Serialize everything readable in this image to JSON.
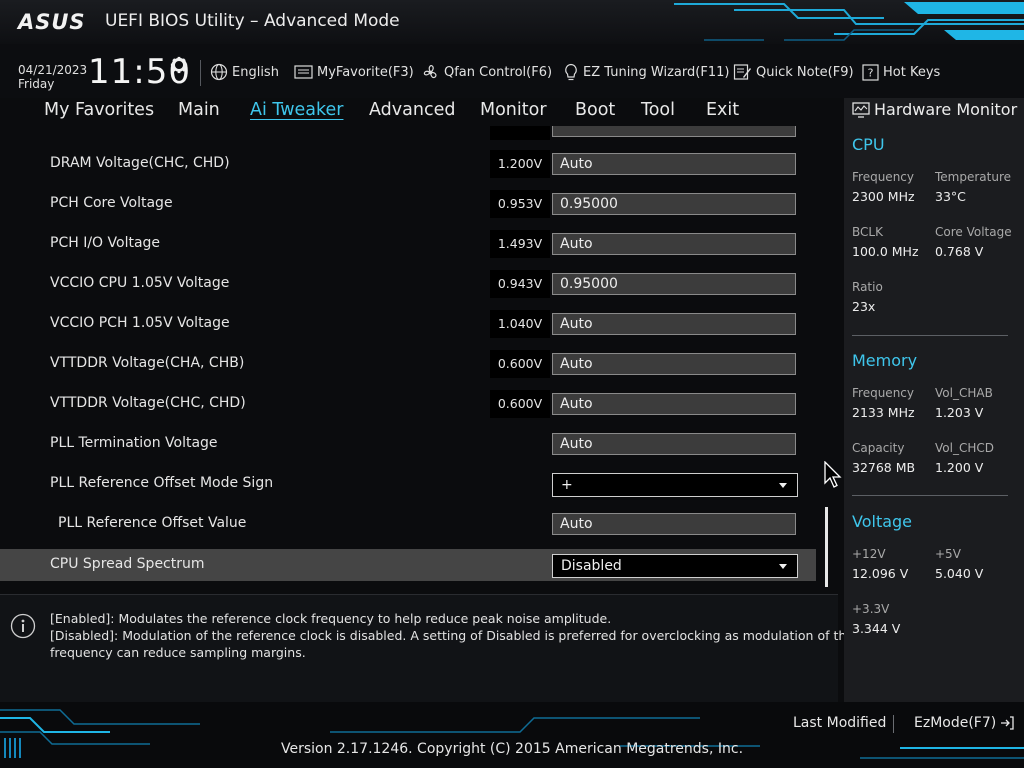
{
  "header": {
    "logo": "ASUS",
    "title": "UEFI BIOS Utility – Advanced Mode"
  },
  "infobar": {
    "date": "04/21/2023",
    "day": "Friday",
    "time": "11:50",
    "tools": [
      {
        "label": "English",
        "icon": "globe-icon"
      },
      {
        "label": "MyFavorite(F3)",
        "icon": "favorite-icon"
      },
      {
        "label": "Qfan Control(F6)",
        "icon": "fan-icon"
      },
      {
        "label": "EZ Tuning Wizard(F11)",
        "icon": "bulb-icon"
      },
      {
        "label": "Quick Note(F9)",
        "icon": "note-icon"
      },
      {
        "label": "Hot Keys",
        "icon": "hotkeys-icon"
      }
    ]
  },
  "menu": {
    "tabs": [
      "My Favorites",
      "Main",
      "Ai Tweaker",
      "Advanced",
      "Monitor",
      "Boot",
      "Tool",
      "Exit"
    ],
    "active": "Ai Tweaker"
  },
  "settings": {
    "rows": [
      {
        "label": "DRAM Voltage(CHC, CHD)",
        "reading": "1.200V",
        "value": "Auto",
        "control": "field"
      },
      {
        "label": "PCH Core Voltage",
        "reading": "0.953V",
        "value": "0.95000",
        "control": "field"
      },
      {
        "label": "PCH I/O Voltage",
        "reading": "1.493V",
        "value": "Auto",
        "control": "field"
      },
      {
        "label": "VCCIO CPU 1.05V Voltage",
        "reading": "0.943V",
        "value": "0.95000",
        "control": "field"
      },
      {
        "label": "VCCIO PCH 1.05V Voltage",
        "reading": "1.040V",
        "value": "Auto",
        "control": "field"
      },
      {
        "label": "VTTDDR Voltage(CHA, CHB)",
        "reading": "0.600V",
        "value": "Auto",
        "control": "field"
      },
      {
        "label": "VTTDDR Voltage(CHC, CHD)",
        "reading": "0.600V",
        "value": "Auto",
        "control": "field"
      },
      {
        "label": "PLL Termination Voltage",
        "reading": "",
        "value": "Auto",
        "control": "field"
      },
      {
        "label": "PLL Reference Offset Mode Sign",
        "reading": "",
        "value": "+",
        "control": "dropdown"
      },
      {
        "label": "PLL Reference Offset Value",
        "reading": "",
        "value": "Auto",
        "control": "field"
      },
      {
        "label": "CPU Spread Spectrum",
        "reading": "",
        "value": "Disabled",
        "control": "dropdown"
      }
    ]
  },
  "help": {
    "lines": [
      "[Enabled]: Modulates the reference clock frequency to help reduce peak noise amplitude.",
      "[Disabled]: Modulation of the reference clock is disabled. A setting of Disabled is preferred for overclocking as modulation of the clock",
      "frequency can reduce sampling margins."
    ]
  },
  "hwmon": {
    "title": "Hardware Monitor",
    "cpu": {
      "heading": "CPU",
      "frequency_label": "Frequency",
      "frequency": "2300 MHz",
      "temperature_label": "Temperature",
      "temperature": "33°C",
      "bclk_label": "BCLK",
      "bclk": "100.0 MHz",
      "core_voltage_label": "Core Voltage",
      "core_voltage": "0.768 V",
      "ratio_label": "Ratio",
      "ratio": "23x"
    },
    "memory": {
      "heading": "Memory",
      "frequency_label": "Frequency",
      "frequency": "2133 MHz",
      "vol_chab_label": "Vol_CHAB",
      "vol_chab": "1.203 V",
      "capacity_label": "Capacity",
      "capacity": "32768 MB",
      "vol_chcd_label": "Vol_CHCD",
      "vol_chcd": "1.200 V"
    },
    "voltage": {
      "heading": "Voltage",
      "v12_label": "+12V",
      "v12": "12.096 V",
      "v5_label": "+5V",
      "v5": "5.040 V",
      "v33_label": "+3.3V",
      "v33": "3.344 V"
    }
  },
  "footer": {
    "last_modified": "Last Modified",
    "ezmode": "EzMode(F7)",
    "version": "Version 2.17.1246. Copyright (C) 2015 American Megatrends, Inc."
  },
  "colors": {
    "accent": "#3fc6ec",
    "selected_row": "#454545",
    "panel": "#1b1c1f"
  }
}
